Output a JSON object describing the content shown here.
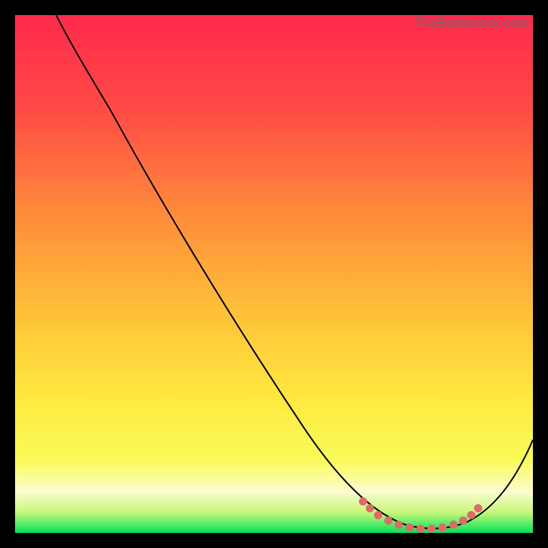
{
  "watermark": "TheBottleneck.com",
  "chart_data": {
    "type": "line",
    "title": "",
    "xlabel": "",
    "ylabel": "",
    "xlim": [
      0,
      100
    ],
    "ylim": [
      0,
      100
    ],
    "grid": false,
    "legend": false,
    "background_gradient": {
      "top": "#ff2a4d",
      "mid_upper": "#ff7a3c",
      "mid": "#ffd43a",
      "mid_lower": "#f6f54a",
      "bottom_band": "#fbfccf",
      "base": "#00e35a"
    },
    "series": [
      {
        "name": "bottleneck-curve",
        "color": "#000000",
        "x": [
          8,
          12,
          18,
          25,
          32,
          40,
          48,
          56,
          64,
          70,
          74,
          78,
          82,
          86,
          90,
          94,
          100
        ],
        "y": [
          100,
          96,
          90,
          80,
          70,
          58,
          46,
          34,
          22,
          12,
          6,
          2,
          1,
          2,
          6,
          12,
          22
        ]
      },
      {
        "name": "optimal-points",
        "color": "#e06a6a",
        "type": "scatter",
        "x": [
          70,
          72,
          74,
          76,
          78,
          80,
          82,
          84,
          86,
          88,
          89,
          90
        ],
        "y": [
          8,
          6,
          4,
          3,
          2,
          2,
          2,
          2,
          3,
          4,
          5,
          7
        ]
      }
    ],
    "annotations": []
  }
}
